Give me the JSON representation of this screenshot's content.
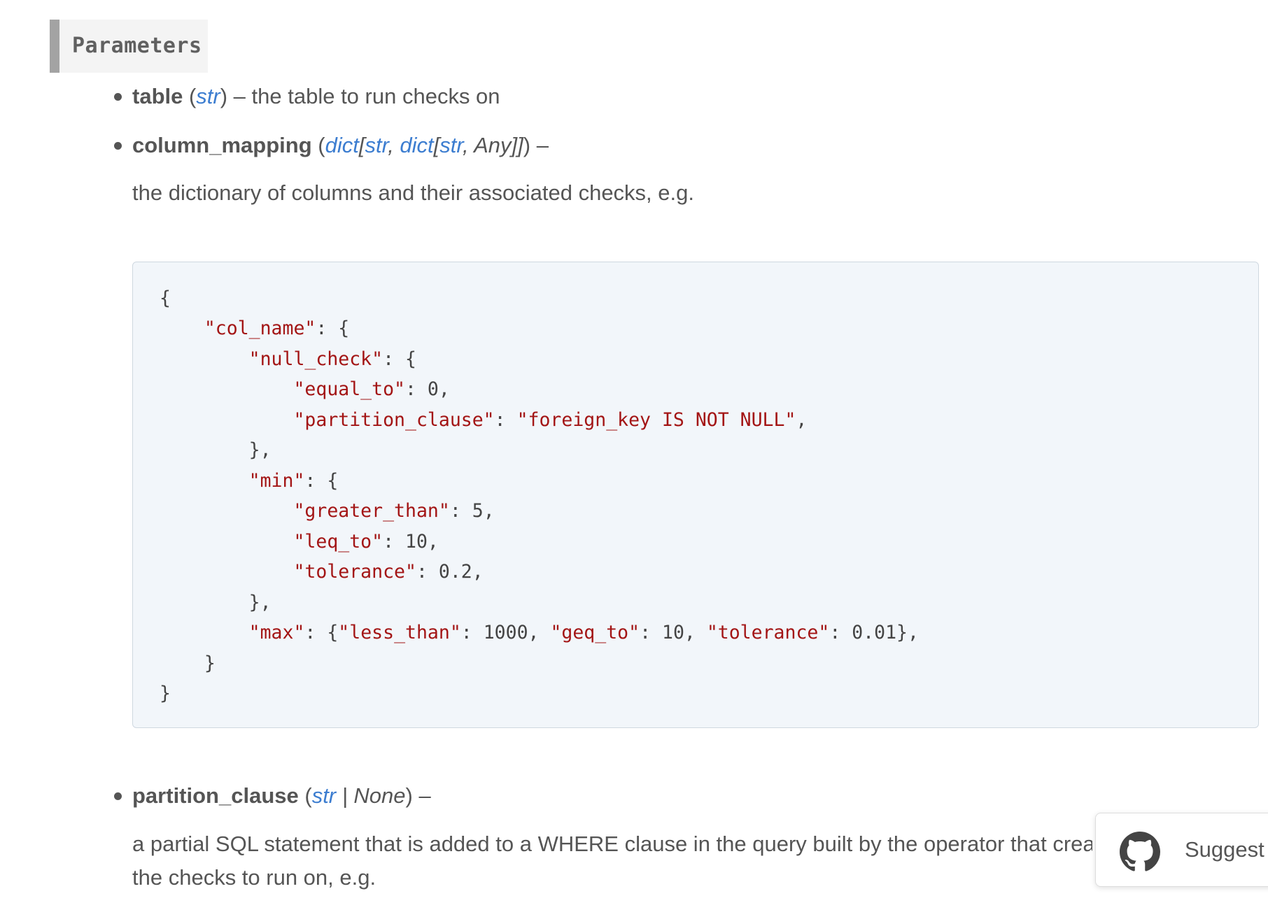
{
  "section": {
    "title": "Parameters"
  },
  "params": {
    "table": {
      "name": "table",
      "open": " (",
      "type": "str",
      "close": ")",
      "dash": " – ",
      "description": "the table to run checks on"
    },
    "column_mapping": {
      "name": "column_mapping",
      "open": " (",
      "t1": "dict",
      "t2": "[",
      "t3": "str",
      "t4": ", ",
      "t5": "dict",
      "t6": "[",
      "t7": "str",
      "t8": ", ",
      "t9": "Any",
      "t10": "]]",
      "close": ")",
      "dash": " –",
      "description": "the dictionary of columns and their associated checks, e.g."
    },
    "partition_clause": {
      "name": "partition_clause",
      "open": " (",
      "t1": "str",
      "t2": " | ",
      "t3": "None",
      "close": ")",
      "dash": " –",
      "description_line1": "a partial SQL statement that is added to a WHERE clause in the query built by the operator that creates part",
      "description_line2": "the checks to run on, e.g."
    }
  },
  "code": {
    "lines": [
      "{",
      "    \"col_name\": {",
      "        \"null_check\": {",
      "            \"equal_to\": 0,",
      "            \"partition_clause\": \"foreign_key IS NOT NULL\",",
      "        },",
      "        \"min\": {",
      "            \"greater_than\": 5,",
      "            \"leq_to\": 10,",
      "            \"tolerance\": 0.2,",
      "        },",
      "        \"max\": {\"less_than\": 1000, \"geq_to\": 10, \"tolerance\": 0.01},",
      "    }",
      "}"
    ]
  },
  "suggest": {
    "label": "Suggest a",
    "icon": "github-icon"
  }
}
